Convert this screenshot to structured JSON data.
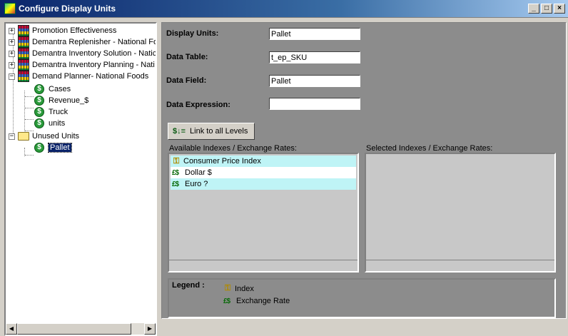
{
  "window": {
    "title": "Configure Display Units",
    "buttons": {
      "minimize": "_",
      "maximize": "□",
      "close": "×"
    }
  },
  "tree": {
    "items": [
      {
        "label": "Promotion Effectiveness",
        "expander": "+"
      },
      {
        "label": "Demantra Replenisher - National Fo",
        "expander": "+"
      },
      {
        "label": "Demantra Inventory Solution - Natic",
        "expander": "+"
      },
      {
        "label": "Demantra Inventory Planning - Nati",
        "expander": "+"
      },
      {
        "label": "Demand Planner- National Foods",
        "expander": "−"
      }
    ],
    "children": [
      {
        "label": "Cases"
      },
      {
        "label": "Revenue_$"
      },
      {
        "label": "Truck"
      },
      {
        "label": "units"
      }
    ],
    "unused": {
      "label": "Unused Units",
      "expander": "−"
    },
    "unused_children": [
      {
        "label": "Pallet"
      }
    ]
  },
  "form": {
    "display_units_label": "Display Units:",
    "display_units_value": "Pallet",
    "data_table_label": "Data Table:",
    "data_table_value": "t_ep_SKU",
    "data_field_label": "Data Field:",
    "data_field_value": "Pallet",
    "data_expression_label": "Data Expression:",
    "data_expression_value": "",
    "link_button": "Link to all Levels"
  },
  "available": {
    "label": "Available Indexes / Exchange Rates:",
    "items": [
      {
        "label": "Consumer Price Index",
        "icon": "key-icon"
      },
      {
        "label": "Dollar $",
        "icon": "exchange-rate-icon"
      },
      {
        "label": "Euro ?",
        "icon": "exchange-rate-icon"
      }
    ]
  },
  "selected": {
    "label": "Selected Indexes / Exchange Rates:",
    "items": []
  },
  "legend": {
    "title": "Legend :",
    "index_label": "Index",
    "exchange_label": "Exchange Rate"
  },
  "colors": {
    "titlebar": "#0a246a",
    "panel": "#8c8c8c",
    "highlight_row": "#bff4f6",
    "selection": "#0a246a"
  }
}
